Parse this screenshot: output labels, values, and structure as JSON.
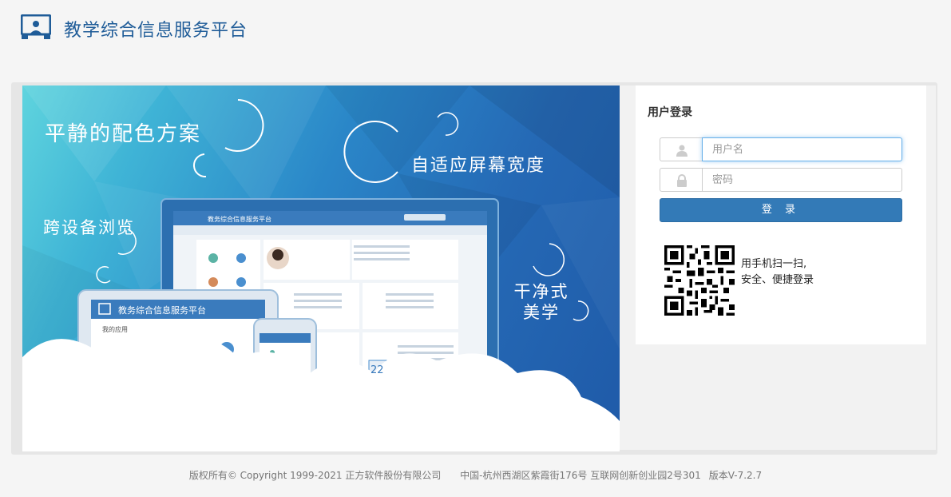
{
  "header": {
    "title": "教学综合信息服务平台",
    "logo_icon": "monitor-person-icon"
  },
  "banner": {
    "text_1": "平静的配色方案",
    "text_2": "自适应屏幕宽度",
    "text_3": "跨设备浏览",
    "text_4_line1": "干净式",
    "text_4_line2": "美学",
    "mock_desktop_title": "教务综合信息服务平台",
    "mock_tablet_title": "教务综合信息服务平台",
    "mock_tablet_section": "我的应用",
    "mock_calendar_day": "22"
  },
  "login": {
    "title": "用户登录",
    "username_placeholder": "用户名",
    "password_placeholder": "密码",
    "submit_label": "登 录",
    "qr_line1": "用手机扫一扫,",
    "qr_line2": "安全、便捷登录"
  },
  "footer": {
    "copyright": "版权所有© Copyright 1999-2021 正方软件股份有限公司",
    "address": "中国-杭州西湖区紫霞街176号 互联网创新创业园2号301",
    "version": "版本V-7.2.7"
  },
  "colors": {
    "brand": "#1f5c98",
    "button": "#337ab7"
  }
}
